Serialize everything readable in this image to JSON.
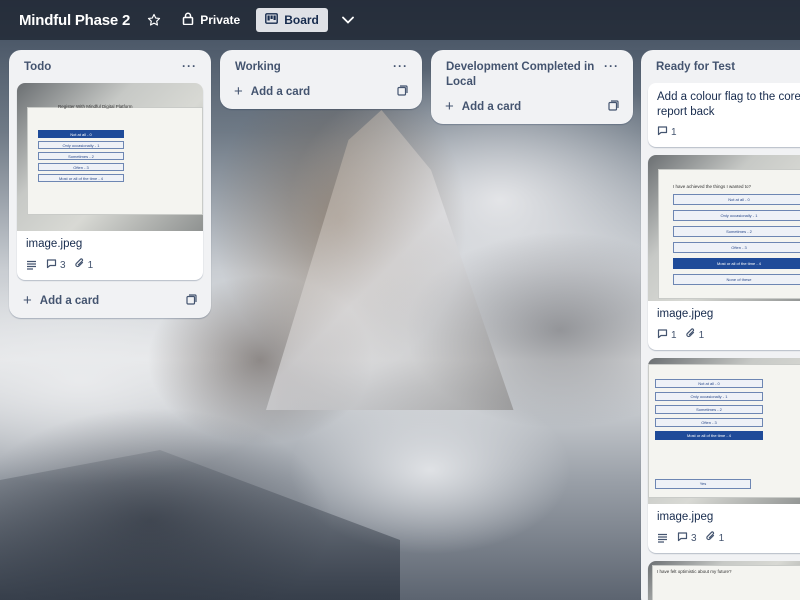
{
  "header": {
    "board_title": "Mindful Phase 2",
    "visibility_label": "Private",
    "view_label": "Board",
    "colors": {
      "header_bg": "#212834",
      "view_btn_bg": "#dfe1e6"
    }
  },
  "icons": [
    "star-icon",
    "lock-icon",
    "board-icon",
    "chevron-down-icon",
    "more-icon",
    "plus-icon",
    "template-icon",
    "description-icon",
    "comment-icon",
    "attachment-icon"
  ],
  "lists": [
    {
      "title": "Todo",
      "menu": "···",
      "add_card_label": "Add a card",
      "cards": [
        {
          "title": "image.jpeg",
          "comments": "3",
          "attachments": "1",
          "cover_heading": "Register With Mindful Digital Platform",
          "cover_options": [
            "Not at all - 0",
            "Only occasionally - 1",
            "Sometimes - 2",
            "Often - 3",
            "Most or all of the time - 4"
          ]
        }
      ]
    },
    {
      "title": "Working",
      "menu": "···",
      "add_card_label": "Add a card"
    },
    {
      "title": "Development Completed in Local",
      "menu": "···",
      "add_card_label": "Add a card"
    },
    {
      "title": "Ready for Test",
      "cards": [
        {
          "title": "Add a colour flag to the core 10 report back",
          "comments": "1"
        },
        {
          "title": "image.jpeg",
          "comments": "1",
          "attachments": "1",
          "cover_heading": "I have achieved the things I wanted to?",
          "cover_options": [
            "Not at all - 0",
            "Only occasionally - 1",
            "Sometimes - 2",
            "Often - 3",
            "Most or all of the time - 4",
            "None of these"
          ]
        },
        {
          "title": "image.jpeg",
          "comments": "3",
          "attachments": "1",
          "cover_options": [
            "Not at all - 0",
            "Only occasionally - 1",
            "Sometimes - 2",
            "Often - 3",
            "Most or all of the time - 4"
          ],
          "cover_button": "Yes"
        },
        {
          "cover_heading": "I have felt optimistic about my future?"
        }
      ]
    }
  ]
}
